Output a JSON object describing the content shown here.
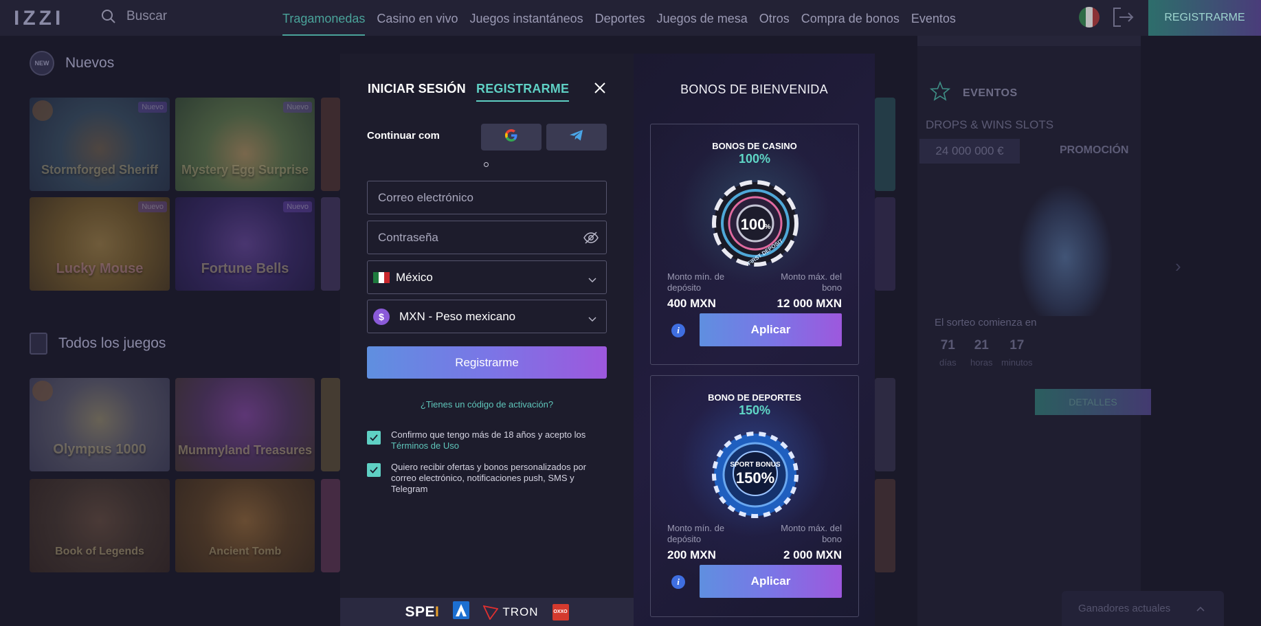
{
  "header": {
    "logo": "IZZI",
    "search_label": "Buscar",
    "nav": [
      "Tragamonedas",
      "Casino en vivo",
      "Juegos instantáneos",
      "Deportes",
      "Juegos de mesa",
      "Otros",
      "Compra de bonos",
      "Eventos"
    ],
    "register_label": "REGISTRARME"
  },
  "sections": {
    "new_title": "Nuevos",
    "all_title": "Todos los juegos",
    "new_badge": "Nuevo"
  },
  "games": {
    "row1": [
      "Stormforged Sheriff",
      "Mystery Egg Surprise"
    ],
    "row2": [
      "Lucky Mouse",
      "Fortune Bells"
    ],
    "row3": [
      "Olympus 1000",
      "Mummyland Treasures"
    ],
    "row4": [
      "Book of Legends",
      "Ancient Tomb"
    ]
  },
  "events": {
    "title": "EVENTOS",
    "subtitle": "DROPS & WINS SLOTS",
    "amount": "24 000 000 €",
    "promo": "PROMOCIÓN",
    "draw_label": "El sorteo comienza en",
    "timer": [
      {
        "value": "71",
        "unit": "días"
      },
      {
        "value": "21",
        "unit": "horas"
      },
      {
        "value": "17",
        "unit": "minutos"
      }
    ],
    "details_label": "DETALLES",
    "winners_label": "Ganadores actuales"
  },
  "modal": {
    "tab_login": "INICIAR SESIÓN",
    "tab_register": "REGISTRARME",
    "continue_label": "Continuar com",
    "email_placeholder": "Correo electrónico",
    "password_placeholder": "Contraseña",
    "country": "México",
    "currency": "MXN - Peso mexicano",
    "register_button": "Registrarme",
    "activation_link": "¿Tienes un código de activación?",
    "terms_text": "Confirmo que tengo más de 18 años y acepto los",
    "terms_link": "Términos de Uso",
    "offers_text": "Quiero recibir ofertas y bonos personalizados por correo electrónico, notificaciones push, SMS y Telegram",
    "payments": {
      "spei_a": "SPE",
      "spei_b": "I",
      "tron": "TRON",
      "oxxo": "OXXO"
    }
  },
  "bonuses": {
    "heading": "BONOS DE BIENVENIDA",
    "cards": [
      {
        "title": "BONOS DE CASINO",
        "percent": "100%",
        "chip_text": "100",
        "chip_sub": "FIRST DEPOSIT",
        "min_label": "Monto mín. de depósito",
        "max_label": "Monto máx. del bono",
        "min_value": "400 MXN",
        "max_value": "12 000 MXN",
        "apply": "Aplicar"
      },
      {
        "title": "BONO DE DEPORTES",
        "percent": "150%",
        "chip_text": "150%",
        "chip_sub": "SPORT BONUS",
        "min_label": "Monto mín. de depósito",
        "max_label": "Monto máx. del bono",
        "min_value": "200 MXN",
        "max_value": "2 000 MXN",
        "apply": "Aplicar"
      }
    ]
  },
  "colors": {
    "accent_teal": "#5fd0c4",
    "button_gradient_start": "#5f8fe0",
    "button_gradient_end": "#9d58dd",
    "modal_bg": "#1d1c2c",
    "page_bg": "#1a1929"
  },
  "icons": [
    "search-icon",
    "logout-icon",
    "close-icon",
    "google-icon",
    "telegram-icon",
    "eye-off-icon",
    "chevron-down-icon",
    "dollar-icon",
    "check-icon",
    "info-icon",
    "star-icon",
    "chevron-right-icon"
  ]
}
